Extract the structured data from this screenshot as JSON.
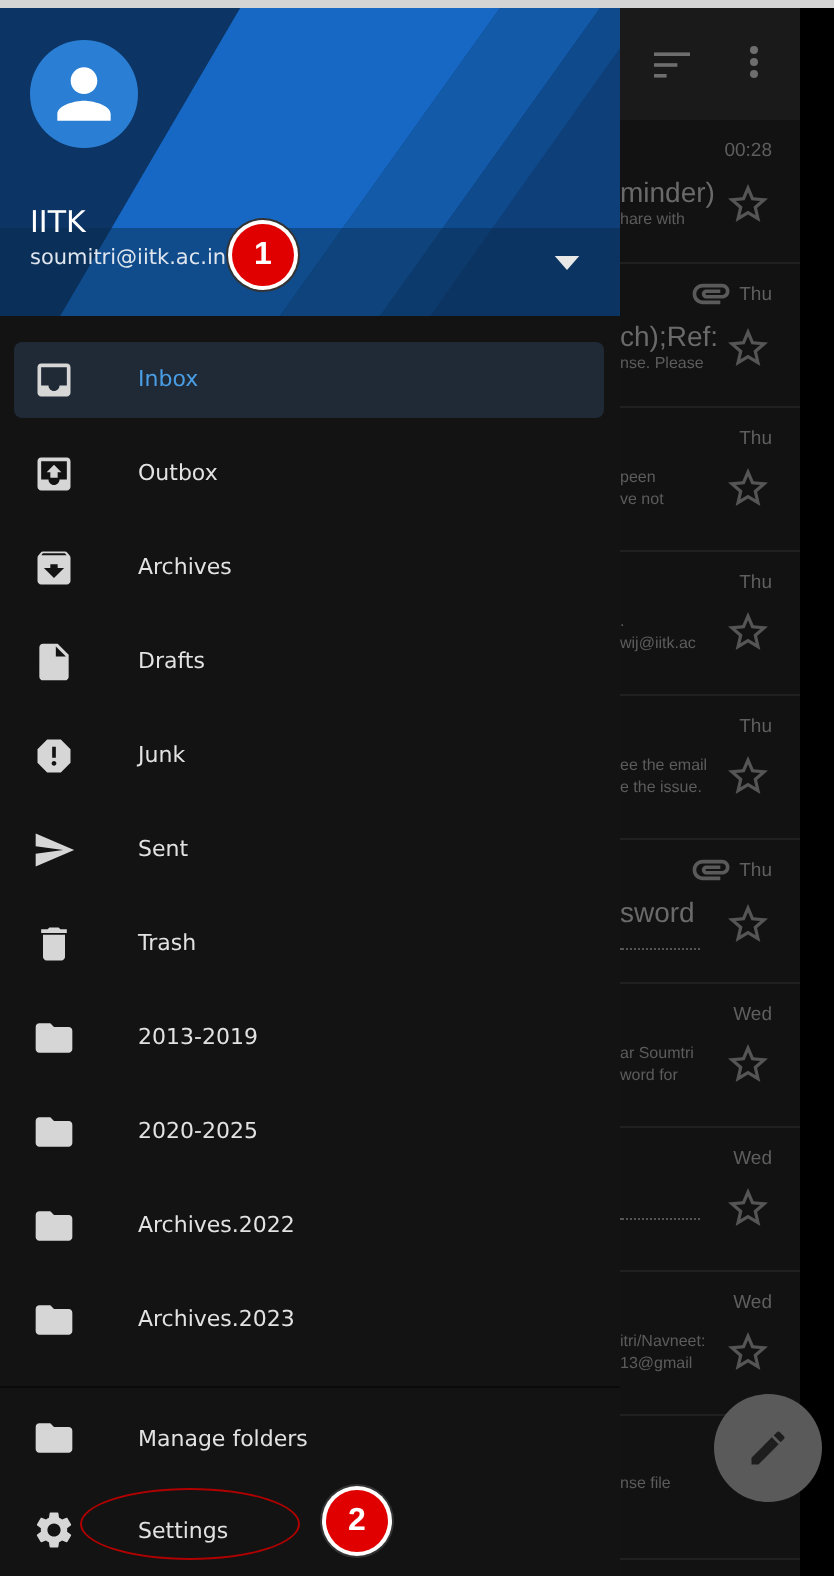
{
  "account": {
    "name": "IITK",
    "email": "soumitri@iitk.ac.in"
  },
  "menu": [
    {
      "label": "Inbox",
      "kind": "inbox",
      "selected": true
    },
    {
      "label": "Outbox",
      "kind": "outbox",
      "selected": false
    },
    {
      "label": "Archives",
      "kind": "archive",
      "selected": false
    },
    {
      "label": "Drafts",
      "kind": "draft",
      "selected": false
    },
    {
      "label": "Junk",
      "kind": "junk",
      "selected": false
    },
    {
      "label": "Sent",
      "kind": "sent",
      "selected": false
    },
    {
      "label": "Trash",
      "kind": "trash",
      "selected": false
    },
    {
      "label": "2013-2019",
      "kind": "folder",
      "selected": false
    },
    {
      "label": "2020-2025",
      "kind": "folder",
      "selected": false
    },
    {
      "label": "Archives.2022",
      "kind": "folder",
      "selected": false
    },
    {
      "label": "Archives.2023",
      "kind": "folder",
      "selected": false
    }
  ],
  "footer": [
    {
      "label": "Manage folders",
      "kind": "folder"
    },
    {
      "label": "Settings",
      "kind": "settings"
    }
  ],
  "messages": [
    {
      "time": "00:28",
      "attachment": false,
      "subject": "minder)",
      "preview": [
        "hare with"
      ],
      "dotted": false
    },
    {
      "time": "Thu",
      "attachment": true,
      "subject": "ch);Ref:",
      "preview": [
        "nse. Please"
      ],
      "dotted": false
    },
    {
      "time": "Thu",
      "attachment": false,
      "preview": [
        "peen",
        "ve not"
      ],
      "dotted": false
    },
    {
      "time": "Thu",
      "attachment": false,
      "preview": [
        ".",
        "wij@iitk.ac"
      ],
      "dotted": false
    },
    {
      "time": "Thu",
      "attachment": false,
      "preview": [
        "ee the email",
        "e the issue."
      ],
      "dotted": false
    },
    {
      "time": "Thu",
      "attachment": true,
      "subject": "sword",
      "dotted": true
    },
    {
      "time": "Wed",
      "attachment": false,
      "preview": [
        "ar Soumtri",
        "word for"
      ],
      "dotted": false
    },
    {
      "time": "Wed",
      "attachment": false,
      "dotted": true
    },
    {
      "time": "Wed",
      "attachment": false,
      "preview": [
        "itri/Navneet:",
        "13@gmail"
      ],
      "dotted": false
    },
    {
      "preview": [
        "nse file"
      ]
    }
  ],
  "annotations": [
    {
      "label": "1",
      "ellipse": false
    },
    {
      "label": "2",
      "ellipse": true
    }
  ]
}
